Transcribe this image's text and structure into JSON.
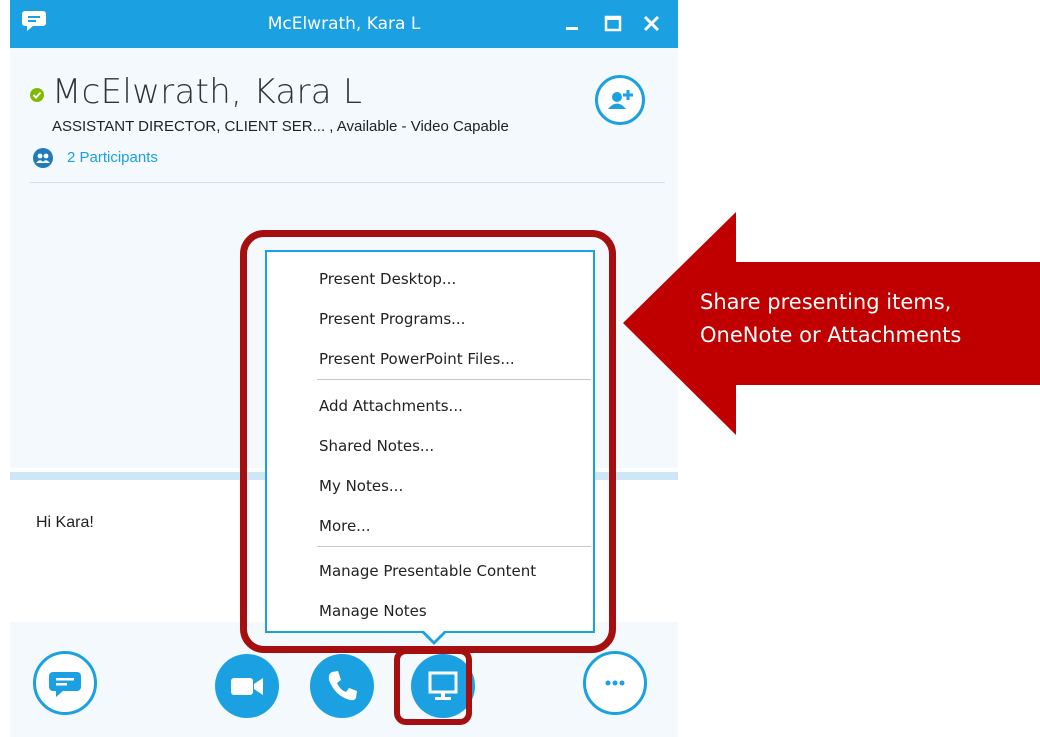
{
  "window": {
    "title": "McElwrath, Kara L",
    "app_icon": "skype-chat-icon",
    "controls": [
      "minimize-icon",
      "maximize-icon",
      "close-icon"
    ]
  },
  "contact": {
    "name": "McElwrath, Kara L",
    "status": "ASSISTANT DIRECTOR, CLIENT SER...   , Available - Video Capable",
    "presence_color": "#7fba00",
    "participants": "2 Participants"
  },
  "compose": {
    "text": "Hi Kara!"
  },
  "present_menu": {
    "groups": [
      [
        {
          "label": "Present Desktop..."
        },
        {
          "label": "Present Programs..."
        },
        {
          "label": "Present PowerPoint Files..."
        }
      ],
      [
        {
          "label": "Add Attachments..."
        },
        {
          "label": "Shared Notes..."
        },
        {
          "label": "My Notes..."
        },
        {
          "label": "More..."
        }
      ],
      [
        {
          "label": "Manage Presentable Content"
        },
        {
          "label": "Manage Notes"
        }
      ]
    ]
  },
  "bottom_bar": {
    "buttons": [
      "im-icon",
      "video-icon",
      "phone-icon",
      "present-icon",
      "more-options-icon"
    ]
  },
  "annotation": {
    "line1": "Share presenting items,",
    "line2": "OneNote or Attachments",
    "color": "#c00000"
  },
  "colors": {
    "accent": "#1ba1e2",
    "highlight": "#a50f10"
  }
}
